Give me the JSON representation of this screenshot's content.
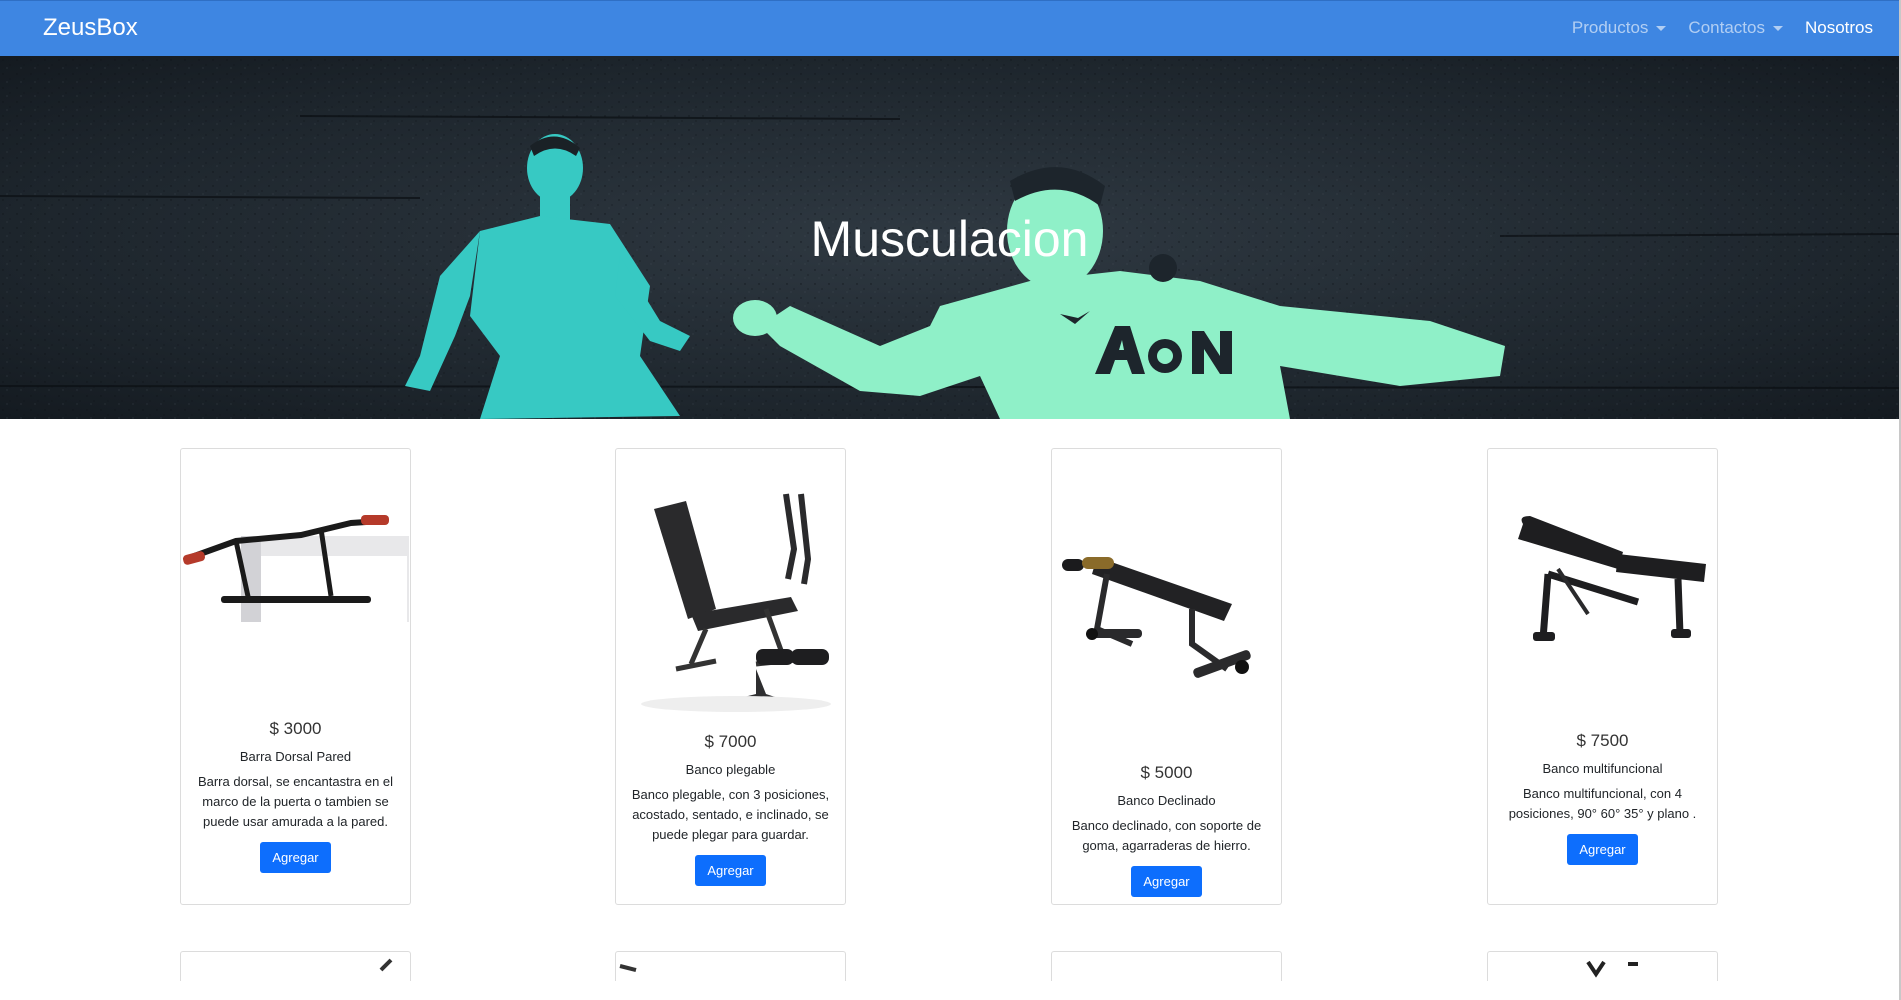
{
  "navbar": {
    "brand": "ZeusBox",
    "items": [
      {
        "label": "Productos",
        "dropdown": true
      },
      {
        "label": "Contactos",
        "dropdown": true
      },
      {
        "label": "Nosotros",
        "dropdown": false
      }
    ]
  },
  "hero": {
    "title": "Musculacion",
    "shirt_text": "AON"
  },
  "products": [
    {
      "price": "$ 3000",
      "title": "Barra Dorsal Pared",
      "description": "Barra dorsal, se encantastra en el marco de la puerta o tambien se puede usar amurada a la pared.",
      "button": "Agregar",
      "image_icon": "pull-up-bar-image"
    },
    {
      "price": "$ 7000",
      "title": "Banco plegable",
      "description": "Banco plegable, con 3 posiciones, acostado, sentado, e inclinado, se puede plegar para guardar.",
      "button": "Agregar",
      "image_icon": "folding-bench-image"
    },
    {
      "price": "$ 5000",
      "title": "Banco Declinado",
      "description": "Banco declinado, con soporte de goma, agarraderas de hierro.",
      "button": "Agregar",
      "image_icon": "decline-bench-image"
    },
    {
      "price": "$ 7500",
      "title": "Banco multifuncional",
      "description": "Banco multifuncional, con 4 posiciones, 90° 60° 35° y plano .",
      "button": "Agregar",
      "image_icon": "multifunction-bench-image"
    }
  ],
  "colors": {
    "navbar": "#3e86e2",
    "button": "#0d6efd",
    "hero_player_left": "#37c9c3",
    "hero_player_right": "#8ff0c8"
  }
}
